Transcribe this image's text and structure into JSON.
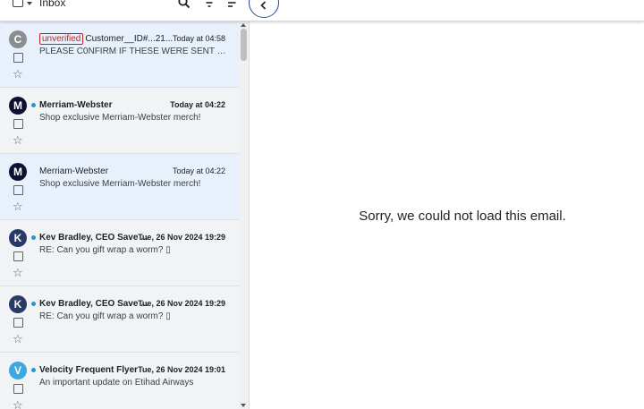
{
  "toolbar": {
    "title": "Inbox",
    "icons": [
      "checkbox-icon",
      "caret-down-icon",
      "search-icon",
      "filter-icon",
      "sort-icon",
      "chevron-left-icon"
    ]
  },
  "messages": [
    {
      "avatar": "C",
      "avatar_color": "#8a8d91",
      "badge": "unverified",
      "sender": "Customer__ID#...21...",
      "date": "Today at 04:58",
      "subject": "PLEASE C0NFIRM IF THESE WERE SENT B...",
      "unread": false,
      "selected": true
    },
    {
      "avatar": "M",
      "avatar_color": "#0f1130",
      "badge": "",
      "sender": "Merriam-Webster",
      "date": "Today at 04:22",
      "subject": "Shop exclusive Merriam-Webster merch!",
      "unread": true,
      "selected": false
    },
    {
      "avatar": "M",
      "avatar_color": "#0f1130",
      "badge": "",
      "sender": "Merriam-Webster",
      "date": "Today at 04:22",
      "subject": "Shop exclusive Merriam-Webster merch!",
      "unread": false,
      "selected": true
    },
    {
      "avatar": "K",
      "avatar_color": "#2a3a66",
      "badge": "",
      "sender": "Kev Bradley, CEO Save ...",
      "date": "Tue, 26 Nov 2024 19:29",
      "subject": "RE: Can you gift wrap a worm? ▯",
      "unread": true,
      "selected": false
    },
    {
      "avatar": "K",
      "avatar_color": "#2a3a66",
      "badge": "",
      "sender": "Kev Bradley, CEO Save ...",
      "date": "Tue, 26 Nov 2024 19:29",
      "subject": "RE: Can you gift wrap a worm? ▯",
      "unread": true,
      "selected": false
    },
    {
      "avatar": "V",
      "avatar_color": "#3ba8de",
      "badge": "",
      "sender": "Velocity Frequent Flyer",
      "date": "Tue, 26 Nov 2024 19:01",
      "subject": "An important update on Etihad Airways",
      "unread": true,
      "selected": false
    }
  ],
  "reading_pane": {
    "message": "Sorry, we could not load this email."
  }
}
